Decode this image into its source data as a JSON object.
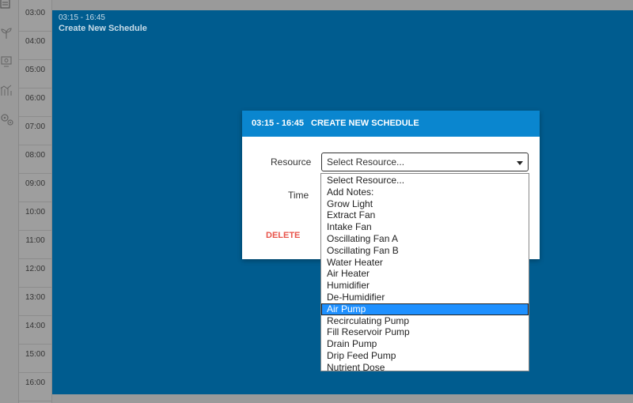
{
  "sidebar": {
    "icons": [
      "calendar-icon",
      "plant-icon",
      "monitor-icon",
      "chart-icon",
      "settings-gears-icon"
    ]
  },
  "times": [
    "03:00",
    "04:00",
    "05:00",
    "06:00",
    "07:00",
    "08:00",
    "09:00",
    "10:00",
    "11:00",
    "12:00",
    "13:00",
    "14:00",
    "15:00",
    "16:00"
  ],
  "event": {
    "time_range": "03:15 - 16:45",
    "title": "Create New Schedule"
  },
  "dialog": {
    "header_time": "03:15 - 16:45",
    "header_title": "CREATE NEW SCHEDULE",
    "resource_label": "Resource",
    "time_label": "Time",
    "select_value": "Select Resource...",
    "delete_label": "DELETE"
  },
  "dropdown": {
    "options": [
      "Select Resource...",
      "Add Notes:",
      "Grow Light",
      "Extract Fan",
      "Intake Fan",
      "Oscillating Fan A",
      "Oscillating Fan B",
      "Water Heater",
      "Air Heater",
      "Humidifier",
      "De-Humidifier",
      "Air Pump",
      "Recirculating Pump",
      "Fill Reservoir Pump",
      "Drain Pump",
      "Drip Feed Pump",
      "Nutrient Dose"
    ],
    "highlighted": "Air Pump"
  },
  "colors": {
    "event_bg": "#005c8f",
    "header_bg": "#0a86cf",
    "highlight": "#1e90ff",
    "delete": "#e8544b"
  }
}
